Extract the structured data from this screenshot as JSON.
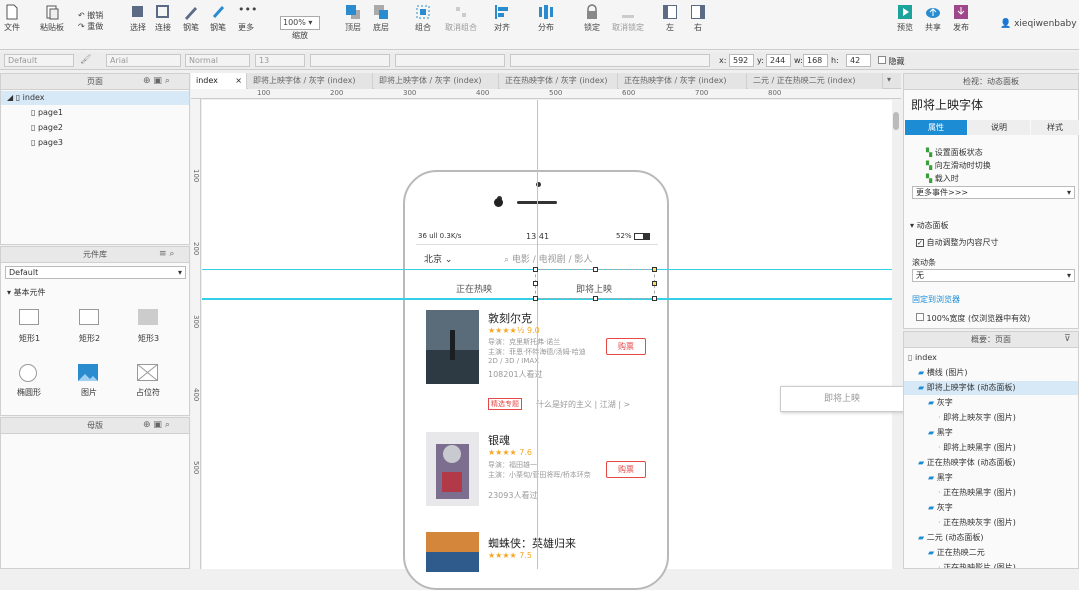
{
  "toolbar": {
    "left": [
      {
        "label": "文件",
        "icon": "file-icon"
      },
      {
        "label": "粘贴板",
        "icon": "paste-icon"
      },
      {
        "label": "撤销",
        "icon": "undo-icon"
      },
      {
        "label": "重做",
        "icon": "redo-icon"
      }
    ],
    "tools": [
      {
        "label": "选择",
        "icon": "select-icon"
      },
      {
        "label": "连接",
        "icon": "connect-icon"
      },
      {
        "label": "钢笔",
        "icon": "pen-icon"
      },
      {
        "label": "更多",
        "icon": "more-icon"
      }
    ],
    "zoom": "100%",
    "zoom_label": "缩放",
    "arrange": [
      {
        "label": "顶层",
        "icon": "bring-front-icon"
      },
      {
        "label": "底层",
        "icon": "send-back-icon"
      },
      {
        "label": "组合",
        "icon": "group-icon"
      },
      {
        "label": "取消组合",
        "icon": "ungroup-icon"
      },
      {
        "label": "对齐",
        "icon": "align-icon"
      },
      {
        "label": "分布",
        "icon": "distribute-icon"
      },
      {
        "label": "锁定",
        "icon": "lock-icon"
      },
      {
        "label": "取消锁定",
        "icon": "unlock-icon"
      },
      {
        "label": "左",
        "icon": "left-panel-icon"
      },
      {
        "label": "右",
        "icon": "right-panel-icon"
      }
    ],
    "right": [
      {
        "label": "预览",
        "icon": "preview-icon"
      },
      {
        "label": "共享",
        "icon": "share-icon"
      },
      {
        "label": "发布",
        "icon": "publish-icon"
      }
    ],
    "user": "xieqiwenbaby"
  },
  "format": {
    "style": "Default",
    "font": "Arial",
    "weight": "Normal",
    "size": "13",
    "x_label": "x:",
    "x": "592",
    "y_label": "y:",
    "y": "244",
    "w_label": "w:",
    "w": "168",
    "h_label": "h:",
    "h": "42",
    "hidden": "隐藏"
  },
  "pages_panel": {
    "title": "页面",
    "items": [
      "index",
      "page1",
      "page2",
      "page3"
    ]
  },
  "library_panel": {
    "title": "元件库",
    "select": "Default",
    "section": "基本元件",
    "widgets": [
      "矩形1",
      "矩形2",
      "矩形3",
      "椭圆形",
      "图片",
      "占位符"
    ]
  },
  "masters_panel": {
    "title": "母版"
  },
  "tabs": [
    "index",
    "即将上映字体 / 灰字 (index)",
    "即将上映字体 / 灰字 (index)",
    "正在热映字体 / 灰字 (index)",
    "正在热映字体 / 灰字 (index)",
    "二元 / 正在热映二元 (index)"
  ],
  "rulers": {
    "h": [
      "100",
      "200",
      "300",
      "400",
      "500",
      "600",
      "700",
      "800"
    ],
    "v": [
      "100",
      "200",
      "300",
      "400",
      "500"
    ]
  },
  "phone": {
    "status_left": "36 ull 0.3K/s",
    "status_time": "13:41",
    "status_right": "52%",
    "city": "北京",
    "search_placeholder": "电影 / 电视剧 / 影人",
    "tab_left": "正在热映",
    "tab_right": "即将上映",
    "movies": [
      {
        "title": "敦刻尔克",
        "rating": "★★★★½ 9.0",
        "line1": "导演：克里斯托弗·诺兰",
        "line2": "主演：菲恩·怀特海德/汤姆·哈迪",
        "line3": "2D / 3D / IMAX",
        "count": "108201人看过",
        "buy": "购票",
        "poster": "poster-dunkirk"
      },
      {
        "title": "银魂",
        "rating": "★★★★ 7.6",
        "line1": "导演：福田雄一",
        "line2": "主演：小栗旬/菅田将晖/桥本环奈",
        "line3": "",
        "count": "23093人看过",
        "buy": "购票",
        "poster": "poster-gintama"
      },
      {
        "title": "蜘蛛侠：英雄归来",
        "rating": "★★★★ 7.5",
        "line1": "",
        "line2": "",
        "line3": "",
        "count": "",
        "buy": "",
        "poster": "poster-spider"
      }
    ],
    "promo_badge": "精选专题",
    "promo_text": "什么是好的主义 | 江湖 | >"
  },
  "floating_label": "即将上映",
  "inspector": {
    "title": "即将上映字体",
    "header": "检视：动态面板",
    "tabs": [
      "属性",
      "说明",
      "样式"
    ],
    "actions": [
      "设置面板状态",
      "向左滑动时切换",
      "载入时"
    ],
    "more_events": "更多事件>>>",
    "section": "动态面板",
    "auto_fit": "自动调整为内容尺寸",
    "scroll_label": "滚动条",
    "scroll_value": "无",
    "fit_link": "固定到浏览器",
    "fit_check": "100%宽度 (仅浏览器中有效)"
  },
  "outline": {
    "title": "概要：页面",
    "items": [
      {
        "t": "index",
        "lvl": 0
      },
      {
        "t": "横线 (图片)",
        "lvl": 1
      },
      {
        "t": "即将上映字体 (动态面板)",
        "lvl": 1,
        "sel": true
      },
      {
        "t": "灰字",
        "lvl": 2
      },
      {
        "t": "即将上映灰字 (图片)",
        "lvl": 3
      },
      {
        "t": "黑字",
        "lvl": 2
      },
      {
        "t": "即将上映黑字 (图片)",
        "lvl": 3
      },
      {
        "t": "正在热映字体 (动态面板)",
        "lvl": 1
      },
      {
        "t": "黑字",
        "lvl": 2
      },
      {
        "t": "正在热映黑字 (图片)",
        "lvl": 3
      },
      {
        "t": "灰字",
        "lvl": 2
      },
      {
        "t": "正在热映灰字 (图片)",
        "lvl": 3
      },
      {
        "t": "二元 (动态面板)",
        "lvl": 1
      },
      {
        "t": "正在热映二元",
        "lvl": 2
      },
      {
        "t": "正在热映影片 (图片)",
        "lvl": 3
      }
    ]
  },
  "colors": {
    "accent": "#1c8dd4",
    "cyan": "#34d0e8",
    "red": "#e54847",
    "star": "#f5a623"
  }
}
